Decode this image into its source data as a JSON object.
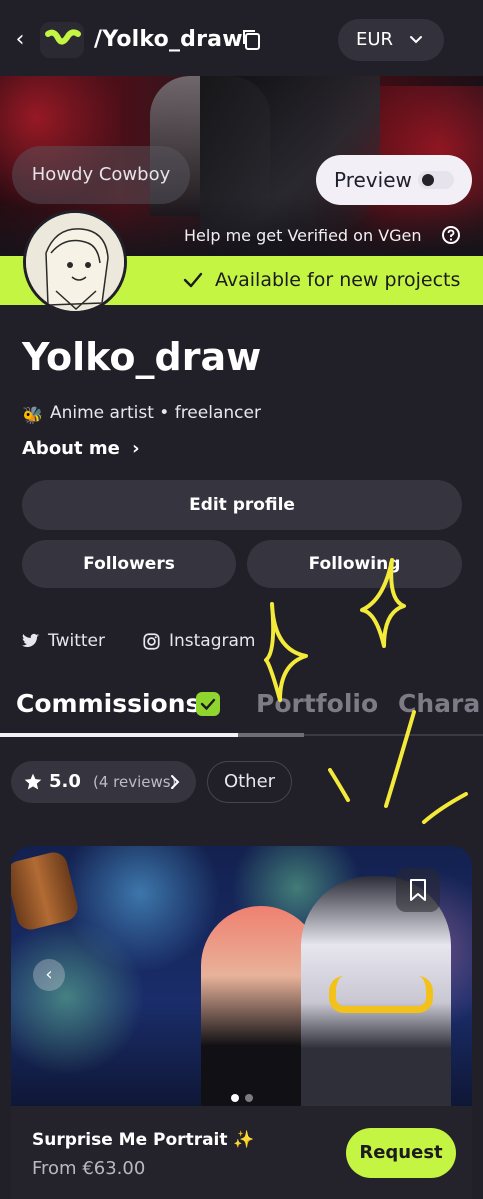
{
  "header": {
    "back_icon": "chevron-left-icon",
    "logo_icon": "vgen-logo-icon",
    "handle": "/Yolko_draw",
    "copy_icon": "copy-icon",
    "currency": "EUR",
    "currency_icon": "chevron-down-icon"
  },
  "banner": {
    "tagline": "Howdy Cowboy",
    "preview_label": "Preview",
    "preview_toggle_on": false,
    "verified_text": "Help me get Verified on VGen",
    "help_icon": "help-circle-icon"
  },
  "availability": {
    "icon": "check-icon",
    "text": "Available for new projects",
    "color": "#c4f542"
  },
  "profile": {
    "name": "Yolko_draw",
    "bio_emoji": "🐝",
    "bio": "Anime artist • freelancer",
    "about": "About me"
  },
  "buttons": {
    "edit_profile": "Edit profile",
    "followers": "Followers",
    "following": "Following"
  },
  "social": [
    {
      "label": "Twitter",
      "icon": "twitter-icon"
    },
    {
      "label": "Instagram",
      "icon": "instagram-icon"
    }
  ],
  "tabs": [
    {
      "label": "Commissions",
      "active": true,
      "badge_icon": "check-badge-icon"
    },
    {
      "label": "Portfolio",
      "active": false
    },
    {
      "label": "Chara",
      "active": false
    }
  ],
  "filters": {
    "rating": "5.0",
    "reviews": "(4 reviews)",
    "other": "Other"
  },
  "commission": {
    "title": "Surprise Me Portrait ✨",
    "price": "From €63.00",
    "request_label": "Request",
    "bookmark_icon": "bookmark-icon",
    "prev_icon": "chevron-left-icon",
    "slide_count": 2,
    "active_slide": 1
  },
  "colors": {
    "background": "#212029",
    "accent": "#c4f542",
    "button": "#35343f"
  }
}
